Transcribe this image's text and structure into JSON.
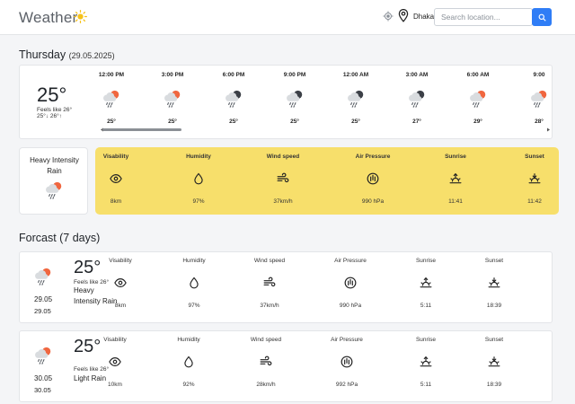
{
  "header": {
    "title": "Weather",
    "title_icon": "sun-icon",
    "locate_icon": "crosshair-icon",
    "pin_icon": "map-pin-icon",
    "city": "Dhaka",
    "search_placeholder": "Search location...",
    "search_button_icon": "search-icon",
    "accent": "#2f7df6"
  },
  "today": {
    "day": "Thursday",
    "date": "(29.05.2025)",
    "temp": "25°",
    "feels_like": "Feels like 26°",
    "minmax": "25°↓   26°↑",
    "hours": [
      {
        "time": "12:00 PM",
        "icon": "cloud-sun-rain-icon",
        "temp": "25°"
      },
      {
        "time": "3:00 PM",
        "icon": "cloud-sun-rain-icon",
        "temp": "25°"
      },
      {
        "time": "6:00 PM",
        "icon": "cloud-moon-rain-icon",
        "temp": "25°"
      },
      {
        "time": "9:00 PM",
        "icon": "cloud-moon-rain-icon",
        "temp": "25°"
      },
      {
        "time": "12:00 AM",
        "icon": "cloud-moon-rain-icon",
        "temp": "25°"
      },
      {
        "time": "3:00 AM",
        "icon": "cloud-moon-rain-icon",
        "temp": "27°"
      },
      {
        "time": "6:00 AM",
        "icon": "cloud-sun-rain-icon",
        "temp": "29°"
      },
      {
        "time": "9:00",
        "icon": "cloud-sun-rain-icon",
        "temp": "28°"
      }
    ],
    "condition": "Heavy Intensity Rain",
    "condition_icon": "cloud-sun-rain-icon",
    "panel_color": "#f7df6b",
    "stats": [
      {
        "label": "Visability",
        "icon": "eye-icon",
        "value": "8km"
      },
      {
        "label": "Humidity",
        "icon": "droplet-icon",
        "value": "97%"
      },
      {
        "label": "Wind speed",
        "icon": "wind-icon",
        "value": "37km/h"
      },
      {
        "label": "Air Pressure",
        "icon": "gauge-icon",
        "value": "990 hPa"
      },
      {
        "label": "Sunrise",
        "icon": "sunrise-icon",
        "value": "11:41"
      },
      {
        "label": "Sunset",
        "icon": "sunset-icon",
        "value": "11:42"
      }
    ]
  },
  "forecast": {
    "title": "Forcast (7 days)",
    "days": [
      {
        "date1": "29.05",
        "date2": "29.05",
        "temp": "25°",
        "feels_like": "Feels like 26°",
        "condition": "Heavy Intensity Rain",
        "icon": "cloud-sun-rain-icon",
        "stats": [
          {
            "label": "Visability",
            "icon": "eye-icon",
            "value": "8km"
          },
          {
            "label": "Humidity",
            "icon": "droplet-icon",
            "value": "97%"
          },
          {
            "label": "Wind speed",
            "icon": "wind-icon",
            "value": "37km/h"
          },
          {
            "label": "Air Pressure",
            "icon": "gauge-icon",
            "value": "990 hPa"
          },
          {
            "label": "Sunrise",
            "icon": "sunrise-icon",
            "value": "5:11"
          },
          {
            "label": "Sunset",
            "icon": "sunset-icon",
            "value": "18:39"
          }
        ]
      },
      {
        "date1": "30.05",
        "date2": "30.05",
        "temp": "25°",
        "feels_like": "Feels like 26°",
        "condition": "Light Rain",
        "icon": "cloud-sun-rain-icon",
        "stats": [
          {
            "label": "Visability",
            "icon": "eye-icon",
            "value": "10km"
          },
          {
            "label": "Humidity",
            "icon": "droplet-icon",
            "value": "92%"
          },
          {
            "label": "Wind speed",
            "icon": "wind-icon",
            "value": "28km/h"
          },
          {
            "label": "Air Pressure",
            "icon": "gauge-icon",
            "value": "992 hPa"
          },
          {
            "label": "Sunrise",
            "icon": "sunrise-icon",
            "value": "5:11"
          },
          {
            "label": "Sunset",
            "icon": "sunset-icon",
            "value": "18:39"
          }
        ]
      }
    ]
  }
}
